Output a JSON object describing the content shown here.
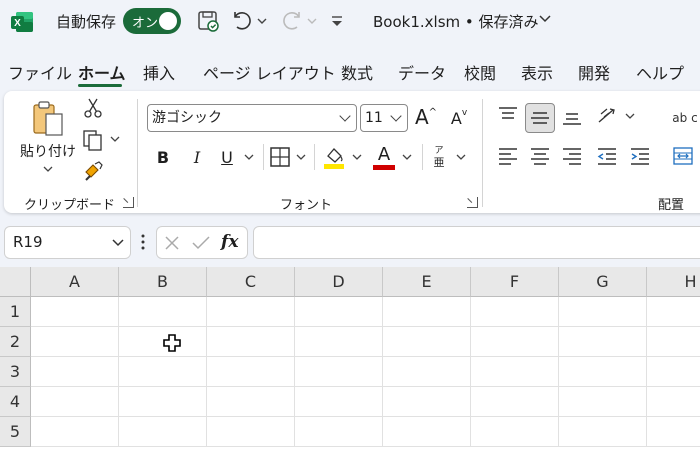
{
  "titlebar": {
    "autosave_label": "自動保存",
    "toggle_state": "オン",
    "doc_title": "Book1.xlsm • 保存済み",
    "logo_letter": "X"
  },
  "tabs": [
    "ファイル",
    "ホーム",
    "挿入",
    "ページ レイアウト",
    "数式",
    "データ",
    "校閲",
    "表示",
    "開発",
    "ヘルプ"
  ],
  "active_tab": "ホーム",
  "ribbon": {
    "clipboard": {
      "label": "クリップボード",
      "paste_label": "貼り付け"
    },
    "font": {
      "label": "フォント",
      "font_name": "游ゴシック",
      "font_size": "11",
      "bold": "B",
      "italic": "I",
      "underline": "U",
      "grow": "A",
      "shrink": "A",
      "font_color_letter": "A",
      "phonetic_top": "ア",
      "phonetic_bottom": "亜",
      "highlight_color": "#ffe600",
      "font_color": "#d00000"
    },
    "alignment": {
      "label": "配置",
      "wrap_text": "ab c"
    }
  },
  "formula_bar": {
    "name_box": "R19",
    "fx": "fx",
    "formula": ""
  },
  "sheet": {
    "columns": [
      "A",
      "B",
      "C",
      "D",
      "E",
      "F",
      "G",
      "H"
    ],
    "rows": [
      "1",
      "2",
      "3",
      "4",
      "5"
    ]
  }
}
